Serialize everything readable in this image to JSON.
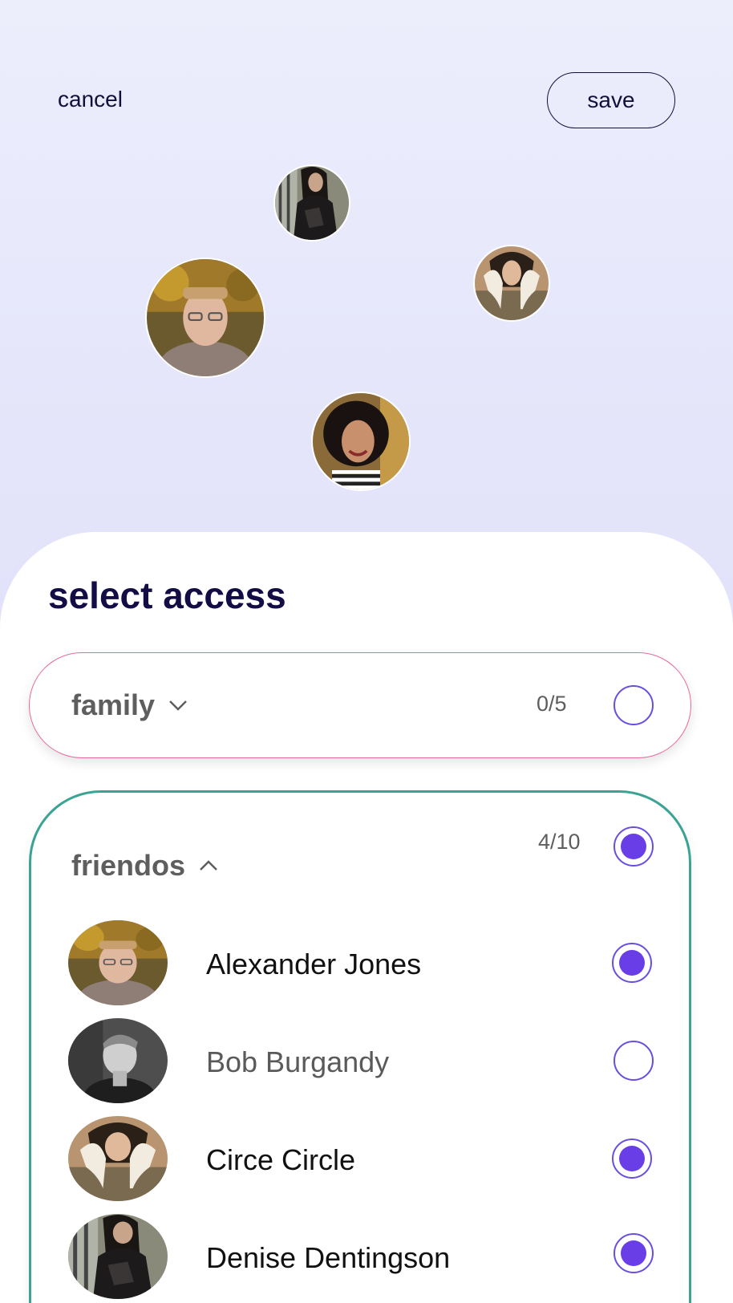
{
  "header": {
    "cancel_label": "cancel",
    "save_label": "save"
  },
  "sheet": {
    "title": "select access"
  },
  "groups": [
    {
      "name": "family",
      "count": "0/5",
      "selected": false,
      "expanded": false,
      "border_color": "#e76aa0"
    },
    {
      "name": "friendos",
      "count": "4/10",
      "selected": true,
      "expanded": true,
      "border_color": "#3aa394",
      "members": [
        {
          "name": "Alexander Jones",
          "selected": true
        },
        {
          "name": "Bob Burgandy",
          "selected": false
        },
        {
          "name": "Circe Circle",
          "selected": true
        },
        {
          "name": "Denise Dentingson",
          "selected": true
        }
      ]
    }
  ],
  "colors": {
    "accent": "#6a3ee6",
    "title": "#130d45",
    "background_top": "#eceefc"
  }
}
